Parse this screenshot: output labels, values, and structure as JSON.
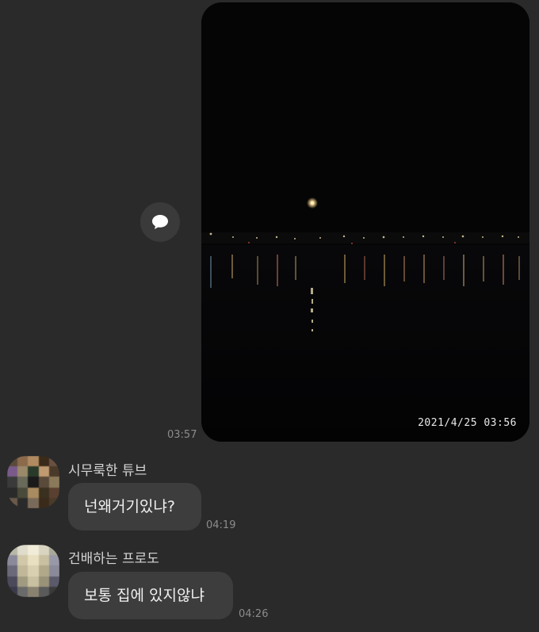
{
  "photo": {
    "timestamp": "2021/4/25  03:56",
    "sent_time": "03:57"
  },
  "share_button": {
    "icon": "speech-bubble-icon"
  },
  "messages": [
    {
      "sender": "시무룩한 튜브",
      "text": "넌왜거기있냐?",
      "time": "04:19",
      "avatar_colors": [
        "#5a4a3a",
        "#8a6a4a",
        "#b08a60",
        "#3a2a1a",
        "#6a5040",
        "#7a5a8a",
        "#9a8a6a",
        "#2a3a2a",
        "#c09a70",
        "#4a3a2a",
        "#3a3a3a",
        "#6a6a5a",
        "#1a1a1a",
        "#5a4a3a",
        "#8a7a5a",
        "#2a2a2a",
        "#4a4a3a",
        "#aa8a60",
        "#3a3020",
        "#5a4030",
        "#6a5a4a",
        "#2a2a2a",
        "#7a6a5a",
        "#3a2a1a",
        "#4a3a2a"
      ]
    },
    {
      "sender": "건배하는 프로도",
      "text": "보통 집에 있지않냐",
      "time": "04:26",
      "avatar_colors": [
        "#b8b8a8",
        "#e0dccc",
        "#f0ecd8",
        "#d8d4c0",
        "#a8a898",
        "#8a8a9a",
        "#d0c8a8",
        "#e8e0c0",
        "#c8c0a0",
        "#9898a8",
        "#6a6a7a",
        "#c0b898",
        "#d8d0b0",
        "#b0a888",
        "#8a8a9a",
        "#4a4a5a",
        "#a09a80",
        "#c8c0a0",
        "#9a9278",
        "#5a5a6a",
        "#3a3a4a",
        "#6a6a6a",
        "#8a8270",
        "#5a5a5a",
        "#3a3a3a"
      ]
    }
  ]
}
